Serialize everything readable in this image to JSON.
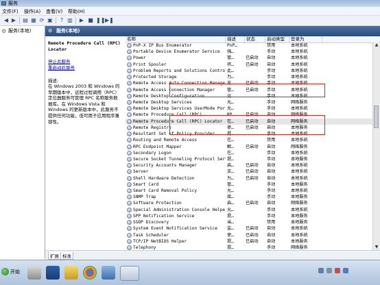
{
  "window": {
    "title": "服务"
  },
  "menu": [
    "文件(F)",
    "操作(A)",
    "查看(V)",
    "帮助(H)"
  ],
  "toolbar": {
    "icons": [
      "back-icon",
      "forward-icon",
      "up-icon",
      "properties-icon",
      "refresh-icon",
      "export-icon",
      "help-icon",
      "play-icon",
      "stop-icon",
      "pause-icon",
      "restart-icon"
    ]
  },
  "tree": {
    "root": "服务(本地)"
  },
  "pane": {
    "header": "服务(本地)"
  },
  "description_panel": {
    "service_name": "Remote Procedure Call (RPC) Locator",
    "stop_link": "停止此服务",
    "restart_link": "重启动此服务",
    "label": "描述:",
    "text": "在 Windows 2003 和 Windows 的早期版本中，远程过程调用（RPC）定位器服务可管理 RPC 名称服务数据库。在 Windows Vista 和 Windows 的更新版本中，此服务不提供任何功能，但可用于应用程序兼容性。"
  },
  "columns": [
    "名称",
    "描述",
    "状态",
    "启动类型",
    "登录为"
  ],
  "services": [
    {
      "name": "PnP-X IP Bus Enumerator",
      "desc": "PnP…",
      "status": "",
      "startup": "禁用",
      "logon": "本地系统"
    },
    {
      "name": "Portable Device Enumerator Service",
      "desc": "强…",
      "status": "",
      "startup": "手动",
      "logon": "本地系统"
    },
    {
      "name": "Power",
      "desc": "管…",
      "status": "已启动",
      "startup": "自动",
      "logon": "本地系统"
    },
    {
      "name": "Print Spooler",
      "desc": "将…",
      "status": "已启动",
      "startup": "自动",
      "logon": "本地系统"
    },
    {
      "name": "Problem Reports and Solutions Control …",
      "desc": "此…",
      "status": "",
      "startup": "手动",
      "logon": "本地系统"
    },
    {
      "name": "Protected Storage",
      "desc": "为…",
      "status": "",
      "startup": "手动",
      "logon": "本地系统"
    },
    {
      "name": "Remote Access Auto Connection Manager",
      "desc": "无…",
      "status": "已启动",
      "startup": "手动",
      "logon": "本地系统"
    },
    {
      "name": "Remote Access Connection Manager",
      "desc": "管…",
      "status": "已启动",
      "startup": "手动",
      "logon": "本地系统"
    },
    {
      "name": "Remote Desktop Configuration",
      "desc": "远…",
      "status": "",
      "startup": "手动",
      "logon": "本地系统"
    },
    {
      "name": "Remote Desktop Services",
      "desc": "允…",
      "status": "",
      "startup": "手动",
      "logon": "网络服务"
    },
    {
      "name": "Remote Desktop Services UserMode Port …",
      "desc": "允…",
      "status": "",
      "startup": "手动",
      "logon": "本地系统"
    },
    {
      "name": "Remote Procedure Call (RPC)",
      "desc": "RP…",
      "status": "已启动",
      "startup": "自动",
      "logon": "网络服务"
    },
    {
      "name": "Remote Procedure Call (RPC) Locator",
      "desc": "在…",
      "status": "已启动",
      "startup": "自动",
      "logon": "网络服务"
    },
    {
      "name": "Remote Registry",
      "desc": "使…",
      "status": "已启动",
      "startup": "自动",
      "logon": "本地服务"
    },
    {
      "name": "Resultant Set of Policy Provider",
      "desc": "提…",
      "status": "",
      "startup": "手动",
      "logon": "本地系统"
    },
    {
      "name": "Routing and Remote Access",
      "desc": "在…",
      "status": "",
      "startup": "禁用",
      "logon": "本地系统"
    },
    {
      "name": "RPC Endpoint Mapper",
      "desc": "解…",
      "status": "已启动",
      "startup": "自动",
      "logon": "网络服务"
    },
    {
      "name": "Secondary Logon",
      "desc": "在…",
      "status": "",
      "startup": "手动",
      "logon": "本地系统"
    },
    {
      "name": "Secure Socket Tunneling Protocol Service",
      "desc": "提…",
      "status": "",
      "startup": "手动",
      "logon": "本地服务"
    },
    {
      "name": "Security Accounts Manager",
      "desc": "启…",
      "status": "已启动",
      "startup": "自动",
      "logon": "本地系统"
    },
    {
      "name": "Server",
      "desc": "支…",
      "status": "已启动",
      "startup": "自动",
      "logon": "本地系统"
    },
    {
      "name": "Shell Hardware Detection",
      "desc": "为…",
      "status": "已启动",
      "startup": "自动",
      "logon": "本地系统"
    },
    {
      "name": "Smart Card",
      "desc": "管…",
      "status": "",
      "startup": "手动",
      "logon": "本地服务"
    },
    {
      "name": "Smart Card Removal Policy",
      "desc": "允…",
      "status": "",
      "startup": "手动",
      "logon": "本地系统"
    },
    {
      "name": "SNMP Trap",
      "desc": "接…",
      "status": "",
      "startup": "手动",
      "logon": "本地服务"
    },
    {
      "name": "Software Protection",
      "desc": "启…",
      "status": "已启动",
      "startup": "自动",
      "logon": "网络服务"
    },
    {
      "name": "Special Administration Console Helper",
      "desc": "允…",
      "status": "",
      "startup": "手动",
      "logon": "本地系统"
    },
    {
      "name": "SPP Notification Service",
      "desc": "提…",
      "status": "",
      "startup": "手动",
      "logon": "本地服务"
    },
    {
      "name": "SSDP Discovery",
      "desc": "当…",
      "status": "",
      "startup": "禁用",
      "logon": "本地服务"
    },
    {
      "name": "System Event Notification Service",
      "desc": "监…",
      "status": "已启动",
      "startup": "自动",
      "logon": "本地系统"
    },
    {
      "name": "Task Scheduler",
      "desc": "使…",
      "status": "已启动",
      "startup": "自动",
      "logon": "本地系统"
    },
    {
      "name": "TCP/IP NetBIOS Helper",
      "desc": "提…",
      "status": "已启动",
      "startup": "自动",
      "logon": "本地服务"
    },
    {
      "name": "Telephony",
      "desc": "提…",
      "status": "",
      "startup": "手动",
      "logon": "网络服务"
    }
  ],
  "selected_service": "Remote Procedure Call (RPC) Locator",
  "tabs": {
    "extended": "扩展",
    "standard": "标准"
  },
  "taskbar": {
    "start": "开始"
  },
  "colors": {
    "highlight_box": "#e0201c",
    "pane_header": "#3a5a8a"
  }
}
